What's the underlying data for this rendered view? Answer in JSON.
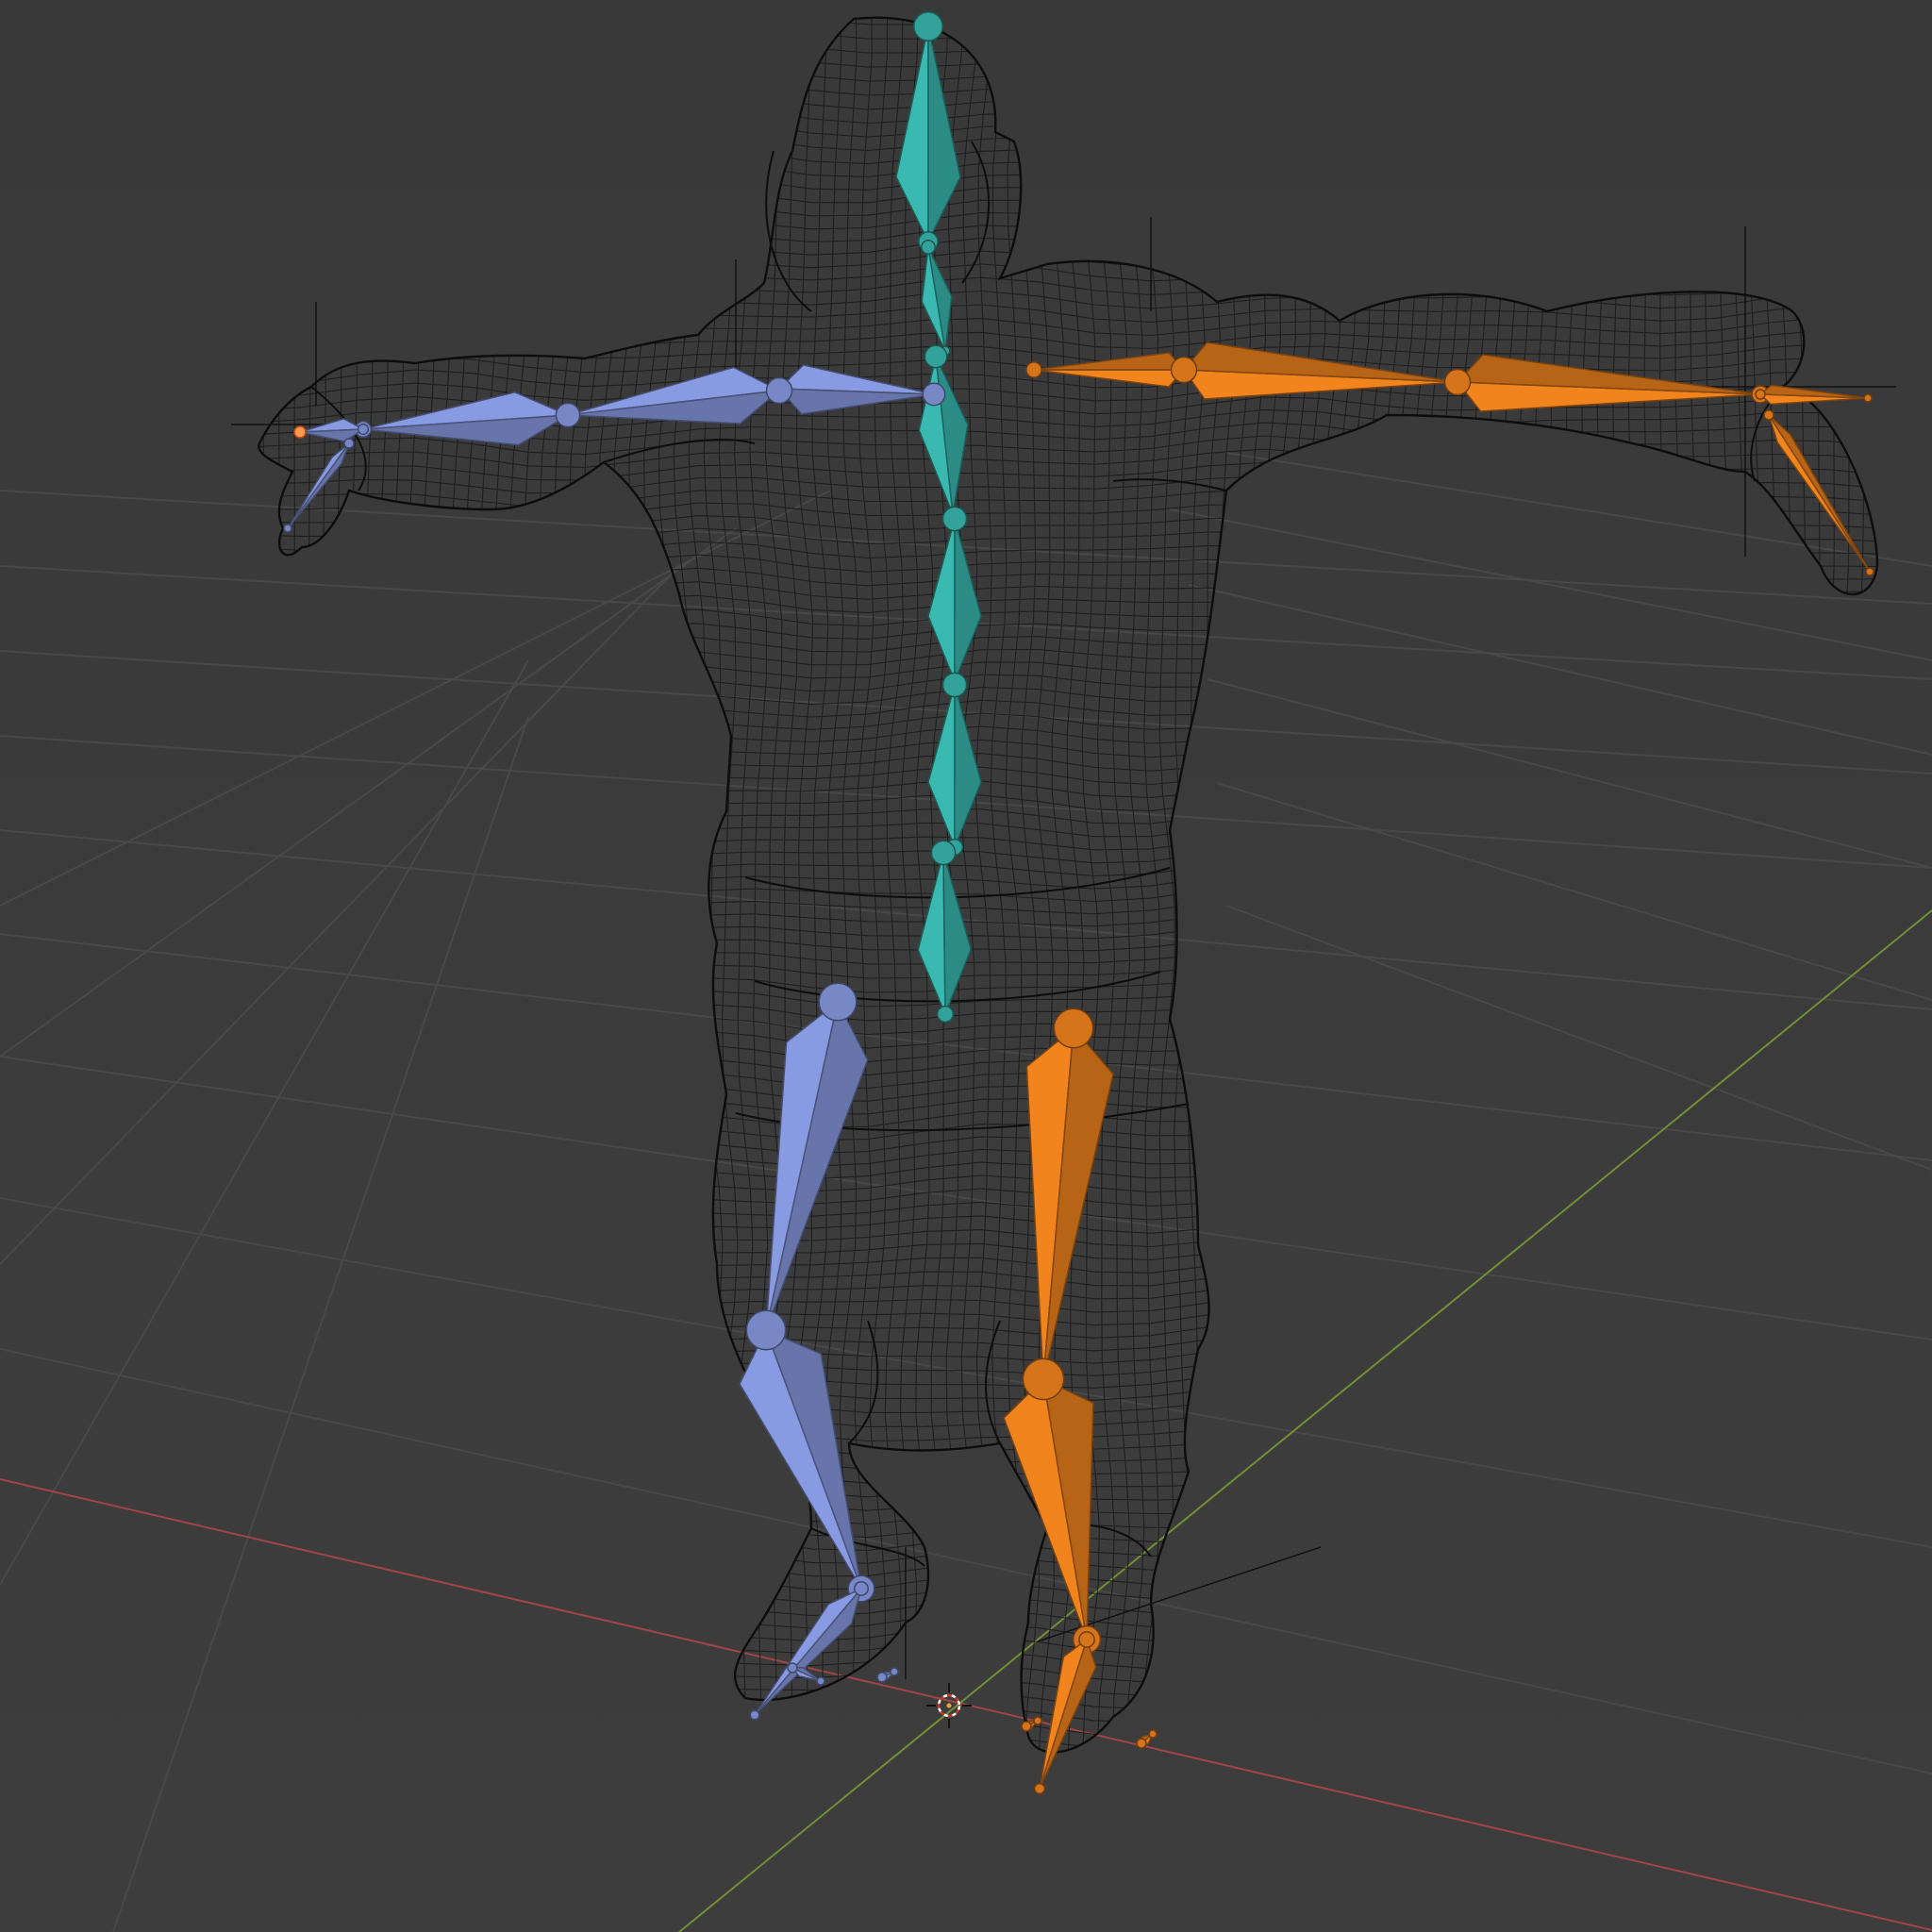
{
  "viewport": {
    "view": "3D Viewport",
    "shading": "wireframe",
    "background_color": "#3b3b3b"
  },
  "scene": {
    "objects": [
      {
        "name": "character-mesh",
        "display": "wireframe",
        "color": "#101010"
      },
      {
        "name": "armature",
        "display": "octahedral"
      }
    ],
    "bone_group_colors": {
      "center": "#35aba3",
      "left": "#7e8fd1",
      "right": "#e07a1c"
    },
    "axis_colors": {
      "x_axis": "#b04040",
      "y_axis": "#7a9a30"
    },
    "icons": [
      "3d-cursor-icon",
      "object-origin-icon"
    ]
  }
}
